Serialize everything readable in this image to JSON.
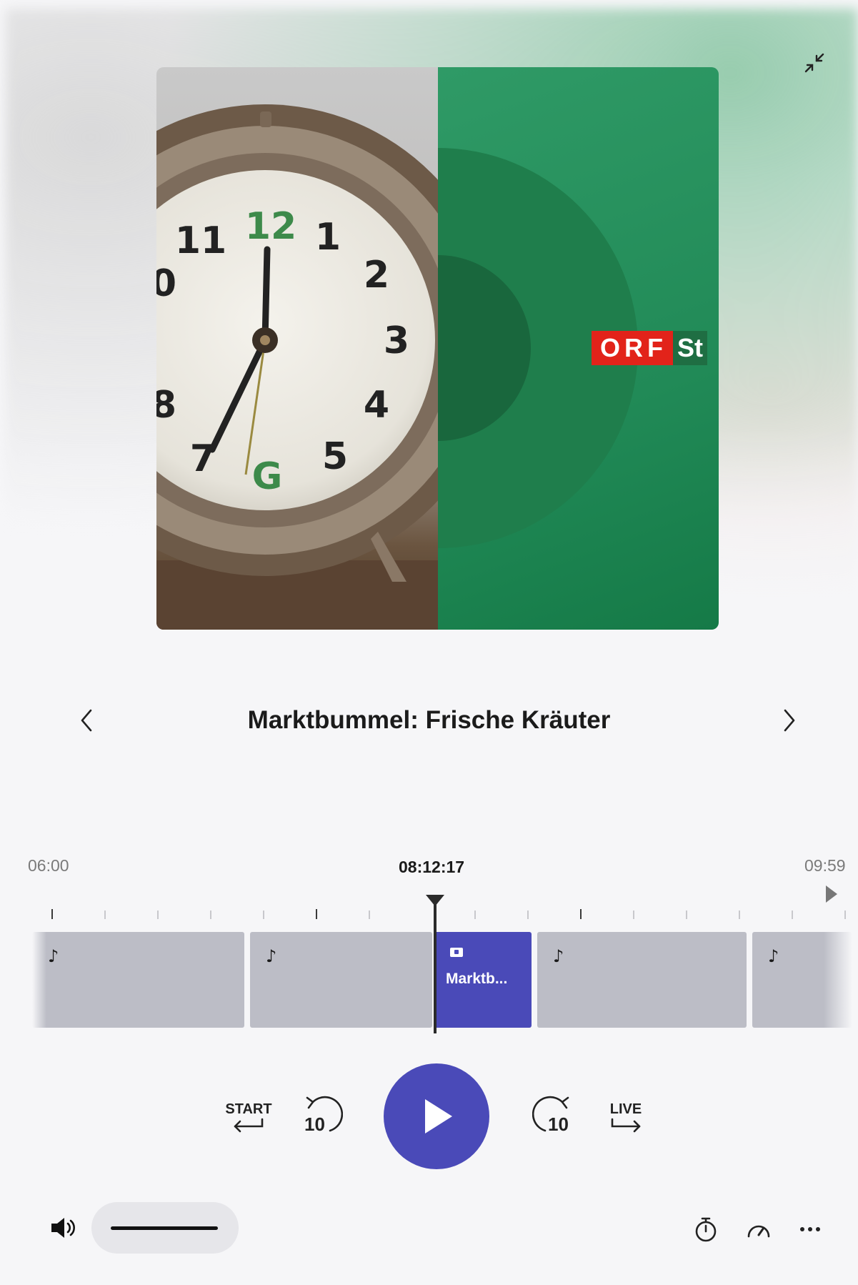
{
  "player": {
    "collapse_icon": "collapse-arrows-icon",
    "cover": {
      "logo_orf": "ORF",
      "logo_station": "St"
    },
    "title": "Marktbummel: Frische Kräuter",
    "nav": {
      "prev_icon": "chevron-left-icon",
      "next_icon": "chevron-right-icon"
    },
    "timeline": {
      "start_time": "06:00",
      "current_time": "08:12:17",
      "end_time": "09:59",
      "segments": [
        {
          "kind": "music",
          "icon": "music-note-icon",
          "label": ""
        },
        {
          "kind": "music",
          "icon": "music-note-icon",
          "label": ""
        },
        {
          "kind": "show",
          "icon": "tv-icon",
          "label": "Marktb..."
        },
        {
          "kind": "music",
          "icon": "music-note-icon",
          "label": ""
        },
        {
          "kind": "music",
          "icon": "music-note-icon",
          "label": ""
        }
      ]
    },
    "controls": {
      "start_label": "START",
      "rewind_label": "10",
      "forward_label": "10",
      "live_label": "LIVE",
      "play_icon": "play-icon"
    },
    "bottom": {
      "volume_icon": "speaker-icon",
      "sleep_timer_icon": "timer-icon",
      "speed_icon": "speedometer-icon",
      "more_icon": "more-dots-icon"
    },
    "accent_color": "#4a4ab8"
  }
}
